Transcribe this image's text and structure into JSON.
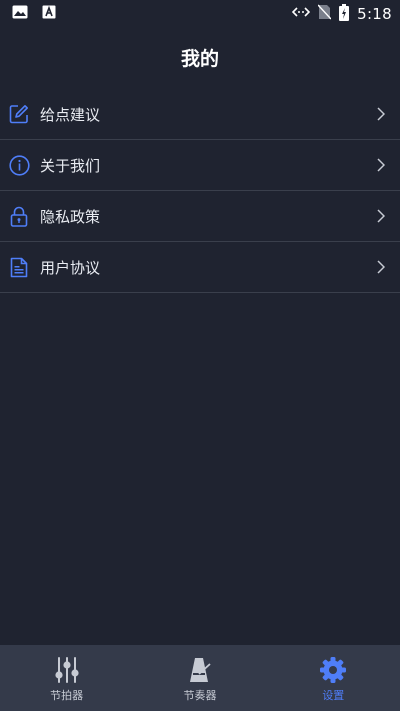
{
  "status_bar": {
    "time": "5:18",
    "icons": [
      "image-icon",
      "text-a-icon",
      "data-sync-icon",
      "no-sim-icon",
      "battery-charging-icon"
    ]
  },
  "header": {
    "title": "我的"
  },
  "menu": {
    "items": [
      {
        "label": "给点建议",
        "icon": "edit-icon"
      },
      {
        "label": "关于我们",
        "icon": "info-icon"
      },
      {
        "label": "隐私政策",
        "icon": "lock-icon"
      },
      {
        "label": "用户协议",
        "icon": "document-icon"
      }
    ]
  },
  "bottom_nav": {
    "items": [
      {
        "label": "节拍器",
        "icon": "sliders-icon",
        "active": false
      },
      {
        "label": "节奏器",
        "icon": "metronome-icon",
        "active": false
      },
      {
        "label": "设置",
        "icon": "settings-gear-icon",
        "active": true
      }
    ]
  },
  "colors": {
    "background": "#1f2330",
    "nav_background": "#343a4a",
    "accent": "#4f7ef8",
    "divider": "#3a3f4c"
  }
}
